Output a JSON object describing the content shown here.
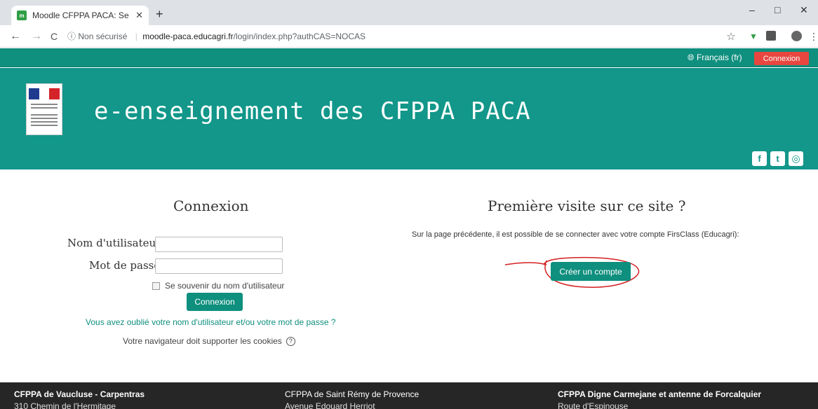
{
  "browser": {
    "tab_title": "Moodle CFPPA PACA: Se connecte",
    "favicon_text": "m",
    "new_tab": "+",
    "window": {
      "minimize": "–",
      "maximize": "□",
      "close": "✕"
    },
    "nav": {
      "back": "←",
      "forward": "→",
      "reload": "C"
    },
    "security_label": "Non sécurisé",
    "url_domain": "moodle-paca.educagri.fr",
    "url_path": "/login/index.php?authCAS=NOCAS",
    "bookmark_star": "☆"
  },
  "topnav": {
    "language": "Français (fr)",
    "login_button": "Connexion"
  },
  "banner": {
    "title": "e-enseignement des CFPPA PACA",
    "social": {
      "facebook": "f",
      "twitter": "t",
      "instagram": "◎"
    }
  },
  "login": {
    "heading": "Connexion",
    "username_label": "Nom d'utilisateur",
    "username_value": "",
    "password_label": "Mot de passe",
    "password_value": "",
    "remember_label": "Se souvenir du nom d'utilisateur",
    "submit": "Connexion",
    "forgot_link": "Vous avez oublié votre nom d'utilisateur et/ou votre mot de passe ?",
    "cookies_text": "Votre navigateur doit supporter les cookies",
    "cookies_help": "?"
  },
  "first_visit": {
    "heading": "Première visite sur ce site ?",
    "text": "Sur la page précédente, il est possible de se connecter avec votre compte FirsClass (Educagri):",
    "create_account": "Créer un compte"
  },
  "footer": {
    "columns": [
      {
        "name": "CFPPA de Vaucluse - Carpentras",
        "address": "310 Chemin de l'Hermitage"
      },
      {
        "name": "CFPPA de Saint Rémy de Provence",
        "address": "Avenue Edouard Herriot"
      },
      {
        "name": "CFPPA Digne Carmejane et antenne de Forcalquier",
        "address": "Route d'Espinouse"
      }
    ]
  },
  "colors": {
    "brand_teal": "#12978a",
    "nav_teal": "#0f8f7e",
    "login_red": "#e8463f",
    "annotation_red": "#d42020",
    "footer_bg": "#262626"
  }
}
